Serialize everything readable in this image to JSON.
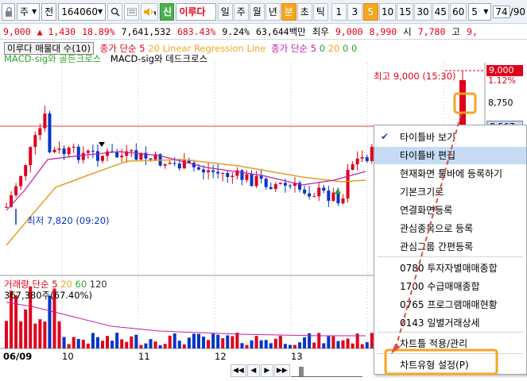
{
  "toolbar": {
    "market": "주",
    "hold_label": "전",
    "code": "164060",
    "name_badge": "신",
    "stock_name": "이루다",
    "periods": [
      "일",
      "주",
      "월",
      "년",
      "분",
      "초",
      "틱"
    ],
    "active_period": "분",
    "intervals": [
      "1",
      "3",
      "5",
      "10",
      "15",
      "30",
      "45",
      "60"
    ],
    "active_interval": "5",
    "count_value": "5",
    "counter": "74",
    "counter_total": "/90"
  },
  "quote": {
    "price": "9,000",
    "change": "▲ 1,430",
    "change_pct": "18.89%",
    "volume": "7,641,532",
    "vol_pct": "683.43%",
    "turnover": "9.24%",
    "amount": "63,644백만",
    "ask_label": "최우",
    "ask1": "9,000",
    "ask2": "8,990",
    "open_label": "시",
    "open": "7,780",
    "high_label": "고",
    "high": "9,"
  },
  "chart": {
    "title": "이루다 매물대 수(10)",
    "ma_label": "종가 단순 5",
    "ma_periods": [
      "20",
      "60",
      "120"
    ],
    "lr_label": "Linear Regression Line",
    "ma2_label": "종가 단순 5",
    "ma2_values": [
      "0",
      "20",
      "0",
      "0"
    ],
    "golden_label": "MACD-sig와 골든크로스",
    "dead_label": "MACD-sig와 데드크로스",
    "high_note": "최고 9,000 (15:30)",
    "low_note": "최저 7,820 (09:20)",
    "price_axis": [
      "9,000",
      "1.12%",
      "8,750",
      "8,567"
    ],
    "vol_title": "거래량",
    "vol_ma_label": "단순 5",
    "vol_ma_periods": [
      "20",
      "60",
      "120"
    ],
    "vol_value": "367,380주(67.40%)",
    "dates": [
      "06/09",
      "10",
      "11",
      "12",
      "13"
    ]
  },
  "context_menu": {
    "items": [
      {
        "label": "타이틀바 보기",
        "checked": true
      },
      {
        "label": "타이틀바 편집",
        "highlighted": true
      },
      {
        "label": "현재화면 툴바에 등록하기"
      },
      {
        "label": "기본크기로"
      },
      {
        "label": "연결화면등록"
      },
      {
        "label": "관심종목으로 등록"
      },
      {
        "label": "관심그룹 간편등록"
      },
      {
        "label": "0780 투자자별매매종합"
      },
      {
        "label": "1700 수급매매종합"
      },
      {
        "label": "0765 프로그램매매현황"
      },
      {
        "label": "0143 일별거래상세"
      },
      {
        "label": "차트틀 적용/관리"
      },
      {
        "label": "차트유형 설정(P)"
      }
    ]
  },
  "colors": {
    "up": "#e0001b",
    "down": "#0035c8",
    "accent": "#f5a623",
    "highlight": "#c6dcf5"
  }
}
